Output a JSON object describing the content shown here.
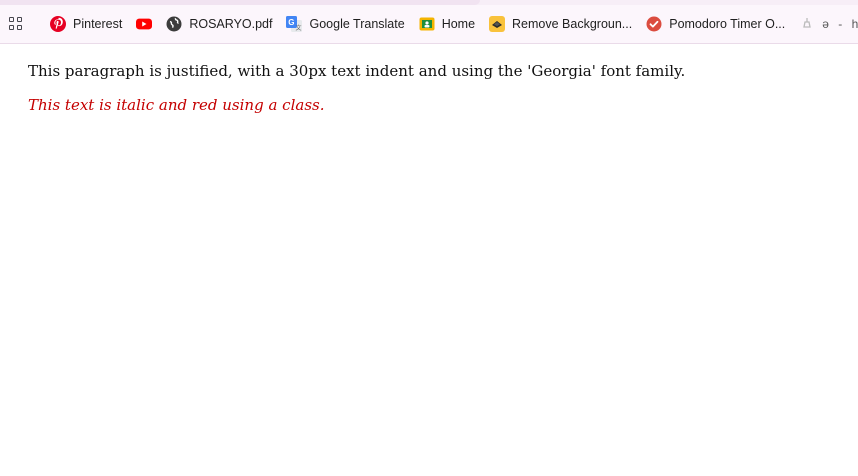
{
  "bookmarks_bar": {
    "apps_icon": "apps-grid-icon",
    "items": [
      {
        "label": "Pinterest",
        "icon": "pinterest-icon",
        "color": "#e60023"
      },
      {
        "label": "",
        "icon": "youtube-icon",
        "color": "#ff0000"
      },
      {
        "label": "ROSARYO.pdf",
        "icon": "globe-icon",
        "color": "#3c3c3c"
      },
      {
        "label": "Google Translate",
        "icon": "google-translate-icon",
        "color": "#4285f4"
      },
      {
        "label": "Home",
        "icon": "home-icon",
        "color": "#f4b400"
      },
      {
        "label": "Remove Backgroun...",
        "icon": "remove-bg-icon",
        "color": "#f9c23c"
      },
      {
        "label": "Pomodoro Timer O...",
        "icon": "pomodoro-check-icon",
        "color": "#db4c3f"
      },
      {
        "label": "ə - h o m",
        "icon": "faded-icon",
        "color": "#bbbbbb"
      }
    ]
  },
  "page": {
    "paragraph": "This paragraph is justified, with a 30px text indent and using the 'Georgia' font family.",
    "italic_text": "This text is italic and red using a class."
  },
  "colors": {
    "italic_text": "#c40000",
    "bookmarks_bg": "#fcf6fc"
  }
}
